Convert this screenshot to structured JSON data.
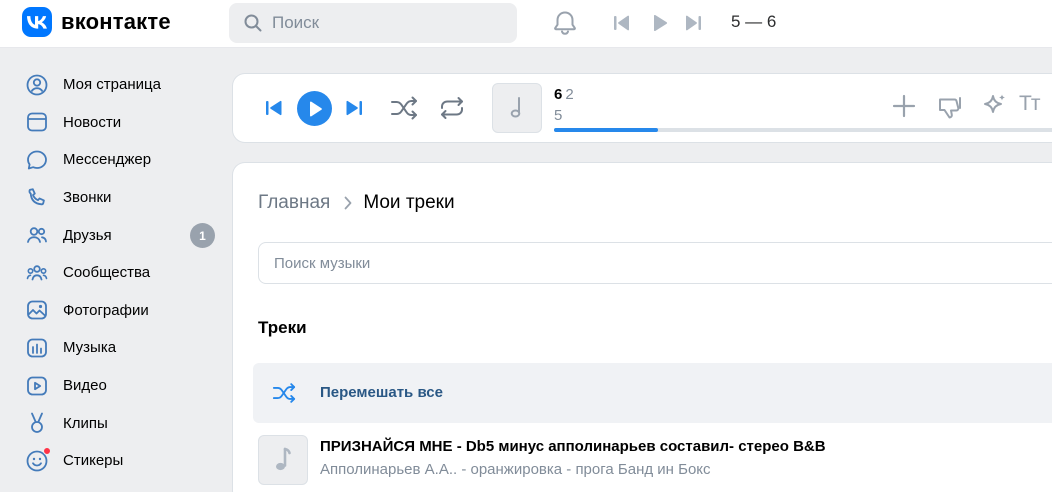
{
  "brand": {
    "name": "вконтакте",
    "accent": "#0077ff"
  },
  "header": {
    "search_placeholder": "Поиск",
    "now_playing": "5 — 6"
  },
  "sidebar": {
    "items": [
      {
        "label": "Моя страница",
        "icon": "user-circle-icon"
      },
      {
        "label": "Новости",
        "icon": "news-icon"
      },
      {
        "label": "Мессенджер",
        "icon": "message-icon"
      },
      {
        "label": "Звонки",
        "icon": "phone-icon"
      },
      {
        "label": "Друзья",
        "icon": "friends-icon",
        "badge": "1"
      },
      {
        "label": "Сообщества",
        "icon": "groups-icon"
      },
      {
        "label": "Фотографии",
        "icon": "photo-icon"
      },
      {
        "label": "Музыка",
        "icon": "music-icon"
      },
      {
        "label": "Видео",
        "icon": "video-icon"
      },
      {
        "label": "Клипы",
        "icon": "clips-icon"
      },
      {
        "label": "Стикеры",
        "icon": "sticker-icon"
      }
    ]
  },
  "player": {
    "title": "6",
    "subtitle": "2",
    "artist": "5",
    "progress": 0.2
  },
  "content": {
    "breadcrumb": {
      "home": "Главная",
      "current": "Мои треки"
    },
    "search_placeholder": "Поиск музыки",
    "section_title": "Треки",
    "shuffle_label": "Перемешать все",
    "tracks": [
      {
        "title": "ПРИЗНАЙСЯ МНЕ - Db5 минус апполинарьев составил- стерео B&B",
        "artist": "Апполинарьев А.А.. - оранжировка - прога Банд ин Бокс"
      }
    ]
  }
}
